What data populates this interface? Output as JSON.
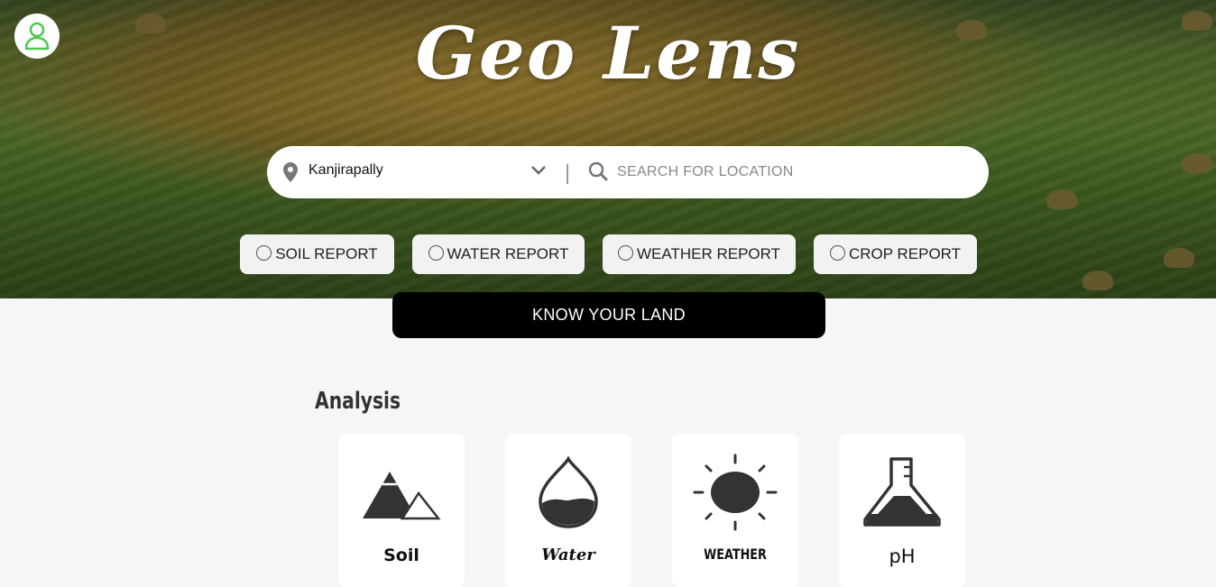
{
  "app": {
    "title": "Geo Lens"
  },
  "search": {
    "location_value": "Kanjirapally",
    "placeholder": "SEARCH FOR LOCATION"
  },
  "report_options": [
    {
      "label": "SOIL REPORT"
    },
    {
      "label": "WATER REPORT"
    },
    {
      "label": "WEATHER REPORT"
    },
    {
      "label": "CROP REPORT"
    }
  ],
  "cta": {
    "label": "KNOW YOUR LAND"
  },
  "analysis": {
    "title": "Analysis",
    "cards": [
      {
        "label": "Soil",
        "icon": "mountain-icon"
      },
      {
        "label": "Water",
        "icon": "water-drop-icon"
      },
      {
        "label": "WEATHER",
        "icon": "sun-icon"
      },
      {
        "label": "pH",
        "icon": "flask-icon"
      }
    ]
  },
  "colors": {
    "accent_user": "#4cc94c",
    "button_bg": "#000000",
    "icon_dark": "#333333"
  }
}
